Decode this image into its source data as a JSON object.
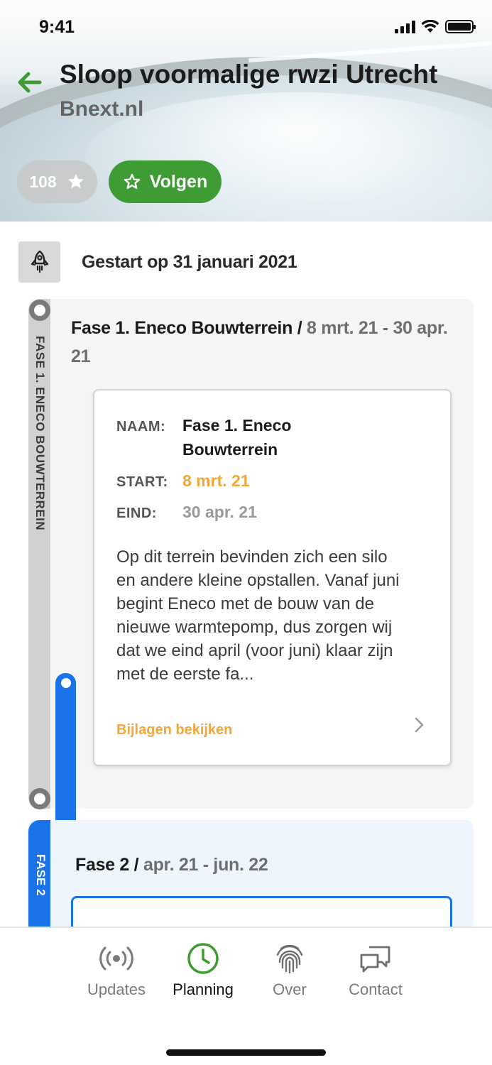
{
  "status_bar": {
    "time": "9:41",
    "signal_icon": "cellular-signal-icon",
    "wifi_icon": "wifi-icon",
    "battery_icon": "battery-icon"
  },
  "header": {
    "title": "Sloop voormalige rwzi Utrecht",
    "subtitle": "Bnext.nl",
    "back_icon": "arrow-left-icon",
    "follower_count": "108",
    "follower_icon": "star-filled-icon",
    "follow_label": "Volgen",
    "follow_icon": "star-outline-icon",
    "background_image": "wastewater-treatment-basin-photo",
    "colors": {
      "accent_green": "#3f9c35",
      "back_arrow": "#3f9c35"
    }
  },
  "timeline": {
    "start_icon": "rocket-icon",
    "start_text": "Gestart op 31 januari 2021",
    "phases": [
      {
        "rail_label": "FASE 1. ENECO BOUWTERREIN",
        "heading_name": "Fase 1. Eneco Bouwterrein /",
        "heading_dates": "8 mrt. 21 - 30 apr. 21",
        "detail": {
          "name_label": "NAAM:",
          "name_value": "Fase 1. Eneco Bouwterrein",
          "start_label": "START:",
          "start_value": "8 mrt. 21",
          "end_label": "EIND:",
          "end_value": "30 apr. 21",
          "description": "Op dit terrein bevinden zich een silo en andere kleine opstallen. Vanaf juni begint Eneco met de bouw van de nieuwe warmtepomp, dus zorgen wij dat we eind april (voor juni) klaar zijn met de eerste fa...",
          "attachments_link": "Bijlagen bekijken",
          "chevron_icon": "chevron-right-icon"
        },
        "colors": {
          "rail": "#d1d1d1",
          "card_bg": "#f5f5f5",
          "start_date": "#f2a73b",
          "end_date": "#9a9a9a"
        }
      },
      {
        "rail_label": "FASE 2",
        "heading_name": "Fase 2 /",
        "heading_dates": "apr. 21 - jun. 22",
        "colors": {
          "rail": "#1a73e8",
          "card_bg": "#eef5fd"
        }
      }
    ]
  },
  "tab_bar": {
    "active_tab": "Planning",
    "tabs": [
      {
        "label": "Updates",
        "icon": "broadcast-icon"
      },
      {
        "label": "Planning",
        "icon": "clock-icon"
      },
      {
        "label": "Over",
        "icon": "fingerprint-icon"
      },
      {
        "label": "Contact",
        "icon": "chat-bubbles-icon"
      }
    ],
    "colors": {
      "active_icon": "#3f9c35",
      "inactive": "#7a7a7a"
    }
  }
}
